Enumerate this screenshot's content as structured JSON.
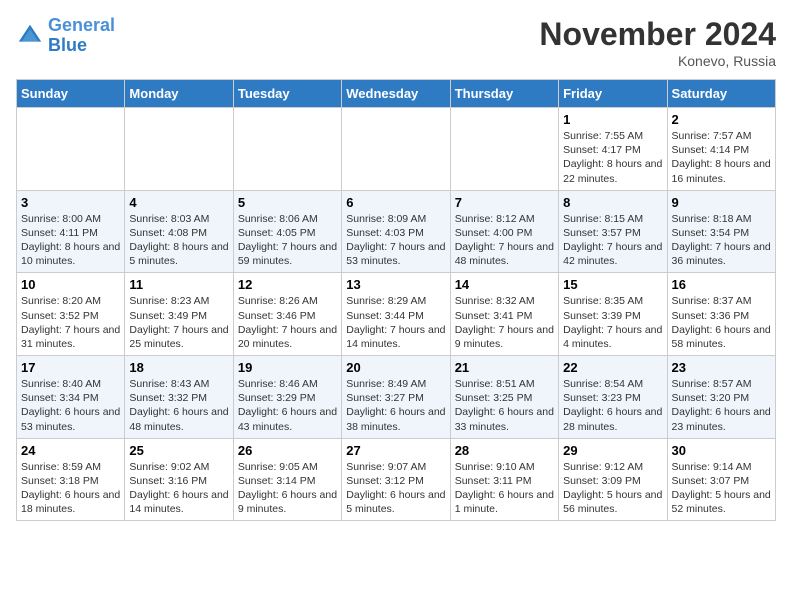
{
  "header": {
    "logo_line1": "General",
    "logo_line2": "Blue",
    "month": "November 2024",
    "location": "Konevo, Russia"
  },
  "weekdays": [
    "Sunday",
    "Monday",
    "Tuesday",
    "Wednesday",
    "Thursday",
    "Friday",
    "Saturday"
  ],
  "weeks": [
    [
      {
        "day": "",
        "info": ""
      },
      {
        "day": "",
        "info": ""
      },
      {
        "day": "",
        "info": ""
      },
      {
        "day": "",
        "info": ""
      },
      {
        "day": "",
        "info": ""
      },
      {
        "day": "1",
        "info": "Sunrise: 7:55 AM\nSunset: 4:17 PM\nDaylight: 8 hours and 22 minutes."
      },
      {
        "day": "2",
        "info": "Sunrise: 7:57 AM\nSunset: 4:14 PM\nDaylight: 8 hours and 16 minutes."
      }
    ],
    [
      {
        "day": "3",
        "info": "Sunrise: 8:00 AM\nSunset: 4:11 PM\nDaylight: 8 hours and 10 minutes."
      },
      {
        "day": "4",
        "info": "Sunrise: 8:03 AM\nSunset: 4:08 PM\nDaylight: 8 hours and 5 minutes."
      },
      {
        "day": "5",
        "info": "Sunrise: 8:06 AM\nSunset: 4:05 PM\nDaylight: 7 hours and 59 minutes."
      },
      {
        "day": "6",
        "info": "Sunrise: 8:09 AM\nSunset: 4:03 PM\nDaylight: 7 hours and 53 minutes."
      },
      {
        "day": "7",
        "info": "Sunrise: 8:12 AM\nSunset: 4:00 PM\nDaylight: 7 hours and 48 minutes."
      },
      {
        "day": "8",
        "info": "Sunrise: 8:15 AM\nSunset: 3:57 PM\nDaylight: 7 hours and 42 minutes."
      },
      {
        "day": "9",
        "info": "Sunrise: 8:18 AM\nSunset: 3:54 PM\nDaylight: 7 hours and 36 minutes."
      }
    ],
    [
      {
        "day": "10",
        "info": "Sunrise: 8:20 AM\nSunset: 3:52 PM\nDaylight: 7 hours and 31 minutes."
      },
      {
        "day": "11",
        "info": "Sunrise: 8:23 AM\nSunset: 3:49 PM\nDaylight: 7 hours and 25 minutes."
      },
      {
        "day": "12",
        "info": "Sunrise: 8:26 AM\nSunset: 3:46 PM\nDaylight: 7 hours and 20 minutes."
      },
      {
        "day": "13",
        "info": "Sunrise: 8:29 AM\nSunset: 3:44 PM\nDaylight: 7 hours and 14 minutes."
      },
      {
        "day": "14",
        "info": "Sunrise: 8:32 AM\nSunset: 3:41 PM\nDaylight: 7 hours and 9 minutes."
      },
      {
        "day": "15",
        "info": "Sunrise: 8:35 AM\nSunset: 3:39 PM\nDaylight: 7 hours and 4 minutes."
      },
      {
        "day": "16",
        "info": "Sunrise: 8:37 AM\nSunset: 3:36 PM\nDaylight: 6 hours and 58 minutes."
      }
    ],
    [
      {
        "day": "17",
        "info": "Sunrise: 8:40 AM\nSunset: 3:34 PM\nDaylight: 6 hours and 53 minutes."
      },
      {
        "day": "18",
        "info": "Sunrise: 8:43 AM\nSunset: 3:32 PM\nDaylight: 6 hours and 48 minutes."
      },
      {
        "day": "19",
        "info": "Sunrise: 8:46 AM\nSunset: 3:29 PM\nDaylight: 6 hours and 43 minutes."
      },
      {
        "day": "20",
        "info": "Sunrise: 8:49 AM\nSunset: 3:27 PM\nDaylight: 6 hours and 38 minutes."
      },
      {
        "day": "21",
        "info": "Sunrise: 8:51 AM\nSunset: 3:25 PM\nDaylight: 6 hours and 33 minutes."
      },
      {
        "day": "22",
        "info": "Sunrise: 8:54 AM\nSunset: 3:23 PM\nDaylight: 6 hours and 28 minutes."
      },
      {
        "day": "23",
        "info": "Sunrise: 8:57 AM\nSunset: 3:20 PM\nDaylight: 6 hours and 23 minutes."
      }
    ],
    [
      {
        "day": "24",
        "info": "Sunrise: 8:59 AM\nSunset: 3:18 PM\nDaylight: 6 hours and 18 minutes."
      },
      {
        "day": "25",
        "info": "Sunrise: 9:02 AM\nSunset: 3:16 PM\nDaylight: 6 hours and 14 minutes."
      },
      {
        "day": "26",
        "info": "Sunrise: 9:05 AM\nSunset: 3:14 PM\nDaylight: 6 hours and 9 minutes."
      },
      {
        "day": "27",
        "info": "Sunrise: 9:07 AM\nSunset: 3:12 PM\nDaylight: 6 hours and 5 minutes."
      },
      {
        "day": "28",
        "info": "Sunrise: 9:10 AM\nSunset: 3:11 PM\nDaylight: 6 hours and 1 minute."
      },
      {
        "day": "29",
        "info": "Sunrise: 9:12 AM\nSunset: 3:09 PM\nDaylight: 5 hours and 56 minutes."
      },
      {
        "day": "30",
        "info": "Sunrise: 9:14 AM\nSunset: 3:07 PM\nDaylight: 5 hours and 52 minutes."
      }
    ]
  ]
}
